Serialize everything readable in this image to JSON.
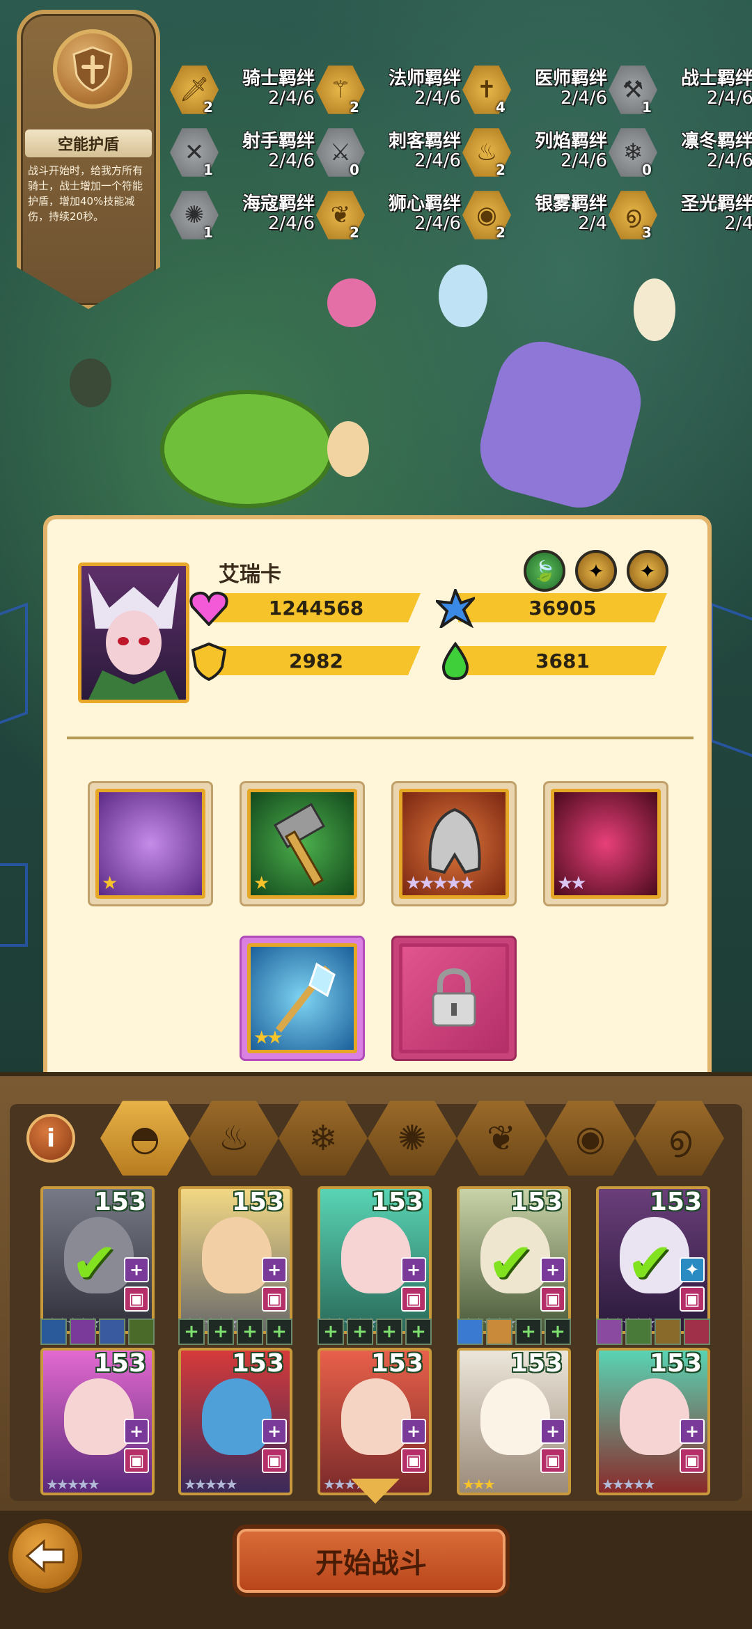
{
  "skill": {
    "title": "空能护盾",
    "desc": "战斗开始时，给我方所有骑士，战士增加一个符能护盾，增加40%技能减伤，持续20秒。"
  },
  "bonds": [
    {
      "name": "骑士羁绊",
      "progress": "2/4/6",
      "count": "2",
      "style": "gold",
      "icon": "sword-icon"
    },
    {
      "name": "法师羁绊",
      "progress": "2/4/6",
      "count": "2",
      "style": "gold",
      "icon": "staff-icon"
    },
    {
      "name": "医师羁绊",
      "progress": "2/4/6",
      "count": "4",
      "style": "gold",
      "icon": "cross-icon"
    },
    {
      "name": "战士羁绊",
      "progress": "2/4/6",
      "count": "1",
      "style": "grey",
      "icon": "axe-icon"
    },
    {
      "name": "射手羁绊",
      "progress": "2/4/6",
      "count": "1",
      "style": "grey",
      "icon": "crossbow-icon"
    },
    {
      "name": "刺客羁绊",
      "progress": "2/4/6",
      "count": "0",
      "style": "grey",
      "icon": "dagger-icon"
    },
    {
      "name": "列焰羁绊",
      "progress": "2/4/6",
      "count": "2",
      "style": "gold",
      "icon": "flame-icon"
    },
    {
      "name": "凛冬羁绊",
      "progress": "2/4/6",
      "count": "0",
      "style": "grey",
      "icon": "snowflake-icon"
    },
    {
      "name": "海寇羁绊",
      "progress": "2/4/6",
      "count": "1",
      "style": "grey",
      "icon": "wave-icon"
    },
    {
      "name": "狮心羁绊",
      "progress": "2/4/6",
      "count": "2",
      "style": "gold",
      "icon": "leaf-icon"
    },
    {
      "name": "银雾羁绊",
      "progress": "2/4",
      "count": "2",
      "style": "gold",
      "icon": "eye-icon"
    },
    {
      "name": "圣光羁绊",
      "progress": "2/4",
      "count": "3",
      "style": "gold",
      "icon": "swirl-icon"
    }
  ],
  "hero": {
    "name": "艾瑞卡",
    "hp": "1244568",
    "attack": "36905",
    "defense": "2982",
    "mana": "3681"
  },
  "roster_levels": [
    "153",
    "153",
    "153",
    "153",
    "153",
    "153",
    "153",
    "153",
    "153",
    "153"
  ],
  "start_label": "开始战斗",
  "info_label": "i",
  "colors": {
    "panel_bg": "#fff6d9",
    "stat_bar": "#f6c32b",
    "accent_gold": "#e8a728"
  }
}
